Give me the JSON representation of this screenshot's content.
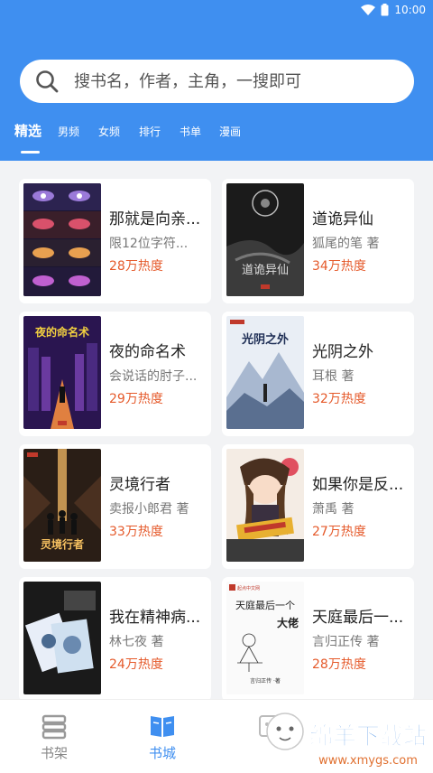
{
  "status_bar": {
    "time": "10:00"
  },
  "search": {
    "placeholder": "搜书名，作者，主角，一搜即可"
  },
  "tabs": [
    {
      "label": "精选",
      "active": true
    },
    {
      "label": "男频"
    },
    {
      "label": "女频"
    },
    {
      "label": "排行"
    },
    {
      "label": "书单"
    },
    {
      "label": "漫画"
    }
  ],
  "books": [
    {
      "title": "那就是向亲...",
      "author": "限12位字符...",
      "heat": "28万热度",
      "cover_icon": "anime-eyes-cover"
    },
    {
      "title": "道诡异仙",
      "author": "狐尾的笔 著",
      "heat": "34万热度",
      "cover_icon": "dark-ink-cover"
    },
    {
      "title": "夜的命名术",
      "author": "会说话的肘子...",
      "heat": "29万热度",
      "cover_icon": "neon-city-cover"
    },
    {
      "title": "光阴之外",
      "author": "耳根 著",
      "heat": "32万热度",
      "cover_icon": "ice-mountain-cover"
    },
    {
      "title": "灵境行者",
      "author": "卖报小郎君 著",
      "heat": "33万热度",
      "cover_icon": "golden-figures-cover"
    },
    {
      "title": "如果你是反...",
      "author": "萧禹 著",
      "heat": "27万热度",
      "cover_icon": "anime-girl-cover"
    },
    {
      "title": "我在精神病...",
      "author": "林七夜 著",
      "heat": "24万热度",
      "cover_icon": "cards-cover"
    },
    {
      "title": "天庭最后一...",
      "author": "言归正传 著",
      "heat": "28万热度",
      "cover_icon": "sketch-cover"
    }
  ],
  "cover_texts": {
    "b1": "道诡异仙",
    "b2": "夜的命名术",
    "b3": "光阴之外",
    "b4": "灵境行者",
    "b6_line1": "天庭最后一个",
    "b6_line2": "大佬",
    "b6_author": "言归正传 ·著",
    "b6_brand": "起点中文网"
  },
  "bottom_nav": [
    {
      "label": "书架",
      "active": false
    },
    {
      "label": "书城",
      "active": true
    },
    {
      "label": "",
      "active": false
    }
  ],
  "watermark": {
    "text": "绵羊下载站",
    "url": "www.xmygs.com"
  },
  "colors": {
    "primary": "#3f8ff0",
    "heat": "#e55a2b"
  }
}
